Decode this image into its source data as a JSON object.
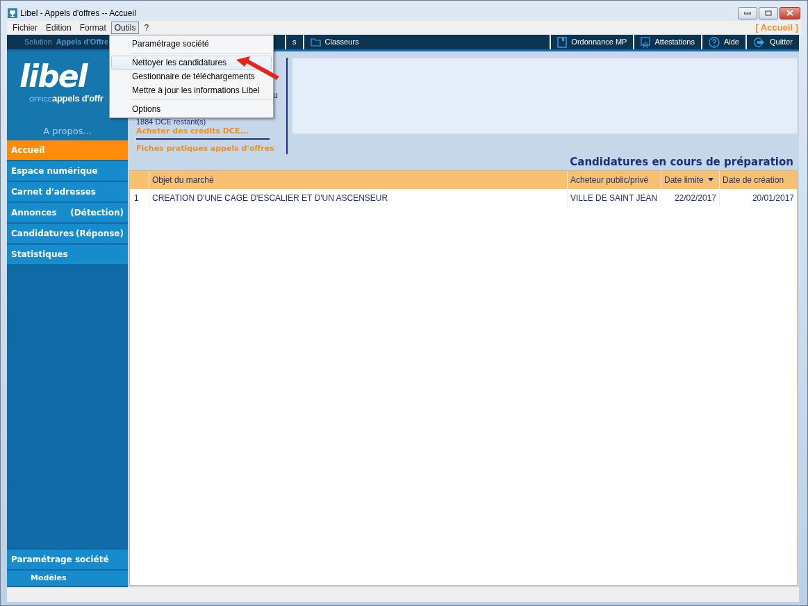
{
  "window": {
    "title": "Libel - Appels d'offres -- Accueil"
  },
  "menubar": {
    "items": [
      {
        "label": "Fichier",
        "selected": false
      },
      {
        "label": "Edition",
        "selected": false
      },
      {
        "label": "Format",
        "selected": false
      },
      {
        "label": "Outils",
        "selected": true
      },
      {
        "label": "?",
        "selected": false
      }
    ],
    "location": "[ Accueil ]"
  },
  "toolbar": {
    "solution_label": "Solution",
    "solution_name": "Appels d'Offre",
    "left_buttons": [
      {
        "label": "s",
        "kind": "plain"
      },
      {
        "label": "Classeurs",
        "kind": "folder"
      }
    ],
    "right_buttons": [
      {
        "label": "Ordonnance MP",
        "kind": "book"
      },
      {
        "label": "Attestations",
        "kind": "certificate"
      },
      {
        "label": "Aide",
        "kind": "help"
      },
      {
        "label": "Quitter",
        "kind": "exit"
      }
    ]
  },
  "dropdown": {
    "items": [
      {
        "label": "Paramétrage société",
        "selected": false,
        "separator_after": true
      },
      {
        "label": "Nettoyer les candidatures",
        "selected": true,
        "separator_after": false
      },
      {
        "label": "Gestionnaire de téléchargements",
        "selected": false,
        "separator_after": false
      },
      {
        "label": "Mettre à jour les informations Libel",
        "selected": false,
        "separator_after": true
      },
      {
        "label": "Options",
        "selected": false,
        "separator_after": false
      }
    ]
  },
  "sidebar": {
    "logo": {
      "name": "libel",
      "prefix": "OFFICE",
      "tagline": "appels d'offr"
    },
    "about": "A propos...",
    "items": [
      {
        "label": "Accueil",
        "selected": true
      },
      {
        "label": "Espace numérique",
        "selected": false
      },
      {
        "label": "Carnet d'adresses",
        "selected": false
      },
      {
        "label": "Annonces",
        "detail": "(Détection)",
        "selected": false
      },
      {
        "label": "Candidatures",
        "detail": "(Réponse)",
        "selected": false
      },
      {
        "label": "Statistiques",
        "selected": false
      }
    ],
    "bottom_items": [
      {
        "label": "Paramétrage société",
        "kind": "main"
      },
      {
        "label": "Modèles",
        "kind": "sub"
      }
    ]
  },
  "home": {
    "links": [
      {
        "text": "u",
        "kind": "fragment",
        "divider_after": false
      },
      {
        "text": "1884 DCE restant(s)",
        "kind": "info",
        "divider_after": false
      },
      {
        "text": "Acheter des crédits DCE...",
        "kind": "action",
        "divider_after": true
      },
      {
        "text": "Fiches pratiques appels d'offres",
        "kind": "action",
        "divider_after": false
      }
    ]
  },
  "panel": {
    "heading": "Candidatures en cours de préparation",
    "table": {
      "columns": [
        {
          "label": "Objet du marché",
          "sorted": false
        },
        {
          "label": "Acheteur public/privé",
          "sorted": false
        },
        {
          "label": "Date limite",
          "sorted": true
        },
        {
          "label": "Date de création",
          "sorted": false
        }
      ],
      "rows": [
        {
          "number": "1",
          "cells": [
            "CREATION D'UNE CAGE D'ESCALIER ET D'UN ASCENSEUR",
            "VILLE DE SAINT JEAN",
            "22/02/2017",
            "20/01/2017"
          ]
        }
      ]
    }
  }
}
